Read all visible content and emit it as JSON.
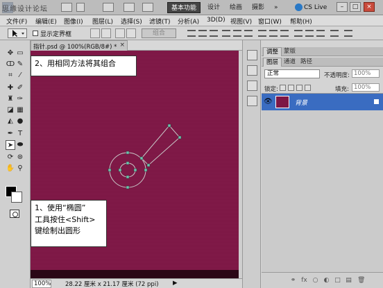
{
  "app": {
    "watermark": "思缘设计论坛",
    "logo_text": "Ps"
  },
  "workspace": {
    "items": [
      "基本功能",
      "设计",
      "绘画",
      "摄影"
    ],
    "active_index": 0,
    "more": "»",
    "cs_live": "CS Live"
  },
  "window_controls": {
    "minimize": "–",
    "restore": "□",
    "close": "×"
  },
  "menu": {
    "items": [
      "文件(F)",
      "编辑(E)",
      "图像(I)",
      "图层(L)",
      "选择(S)",
      "滤镜(T)",
      "分析(A)",
      "3D(D)",
      "视图(V)",
      "窗口(W)",
      "帮助(H)"
    ]
  },
  "options": {
    "show_bounding_box": "显示定界框",
    "group_button": "组合"
  },
  "document": {
    "tab_title": "指针.psd @ 100%(RGB/8#) *",
    "close": "×",
    "canvas_color": "#7d1745"
  },
  "status": {
    "zoom": "100%",
    "info": "28.22 厘米 x 21.17 厘米 (72 ppi)",
    "arrow": "▶"
  },
  "callouts": {
    "top": "2、用相同方法将其组合",
    "bottom_line1": "1、使用“椭圆”",
    "bottom_line2": "工具按住<Shift>",
    "bottom_line3": "键绘制出圆形"
  },
  "panels": {
    "tabs_top": [
      "调整",
      "蒙版"
    ],
    "tabs_layers": [
      "图层",
      "通道",
      "路径"
    ],
    "blend_mode": "正常",
    "opacity_label": "不透明度:",
    "opacity_value": "100%",
    "lock_label": "锁定:",
    "fill_label": "填充:",
    "fill_value": "100%",
    "layer_name": "背景",
    "bottom_icons": [
      "fx",
      "○",
      "◐",
      "□",
      "▤",
      "🗑"
    ]
  }
}
